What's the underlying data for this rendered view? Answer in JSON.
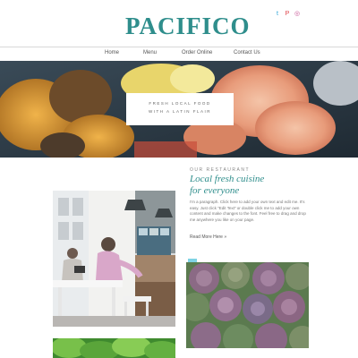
{
  "brand": {
    "logo_text": "PACIFICO",
    "accent_color": "#2f8e8c"
  },
  "social": [
    {
      "name": "twitter-icon",
      "glyph": "t"
    },
    {
      "name": "pinterest-icon",
      "glyph": "P"
    },
    {
      "name": "instagram-icon",
      "glyph": "◎"
    }
  ],
  "nav": {
    "items": [
      "Home",
      "Menu",
      "Order Online",
      "Contact Us"
    ]
  },
  "hero": {
    "line1": "FRESH LOCAL FOOD",
    "line2": "WITH A LATIN FLAIR"
  },
  "about": {
    "label": "OUR RESTAURANT",
    "title_line1": "Local fresh cuisine",
    "title_line2": "for everyone",
    "body": "I'm a paragraph. Click here to add your own text and edit me. It's easy. Just click \"Edit Text\" or double click me to add your own content and make changes to the font. Feel free to drag and drop me anywhere you like on your page.",
    "read_more": "Read More Here »"
  }
}
